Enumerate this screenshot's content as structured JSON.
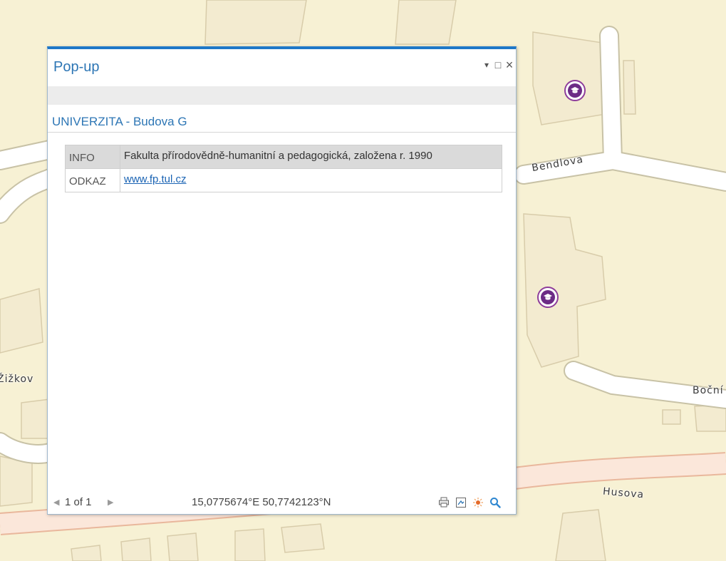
{
  "map": {
    "street_labels": {
      "bendlova": "Bendlova",
      "zizkova": "Žižkov",
      "bocni": "Boční",
      "husova": "Husova"
    },
    "poi_icon": "graduation-cap-icon"
  },
  "popup": {
    "title": "Pop-up",
    "controls": {
      "pin": "▾",
      "maximize": "□",
      "close": "×"
    },
    "feature_title": "UNIVERZITA - Budova G",
    "attributes": [
      {
        "key": "INFO",
        "value": "Fakulta přírodovědně-humanitní a pedagogická, založena r. 1990"
      },
      {
        "key": "ODKAZ",
        "value": "www.fp.tul.cz"
      }
    ],
    "footer": {
      "prev": "◀",
      "page": "1 of 1",
      "next": "▶",
      "coordinates": "15,0775674°E 50,7742123°N",
      "tools": [
        "print-icon",
        "export-icon",
        "flash-icon",
        "zoom-to-icon"
      ]
    }
  },
  "colors": {
    "map_background": "#f7f1d4",
    "building_fill": "#f4ecd2",
    "road_fill": "#ffffff",
    "main_road": "#f5c9b2",
    "accent_blue": "#2d76b5",
    "poi_purple": "#6c2b86"
  }
}
